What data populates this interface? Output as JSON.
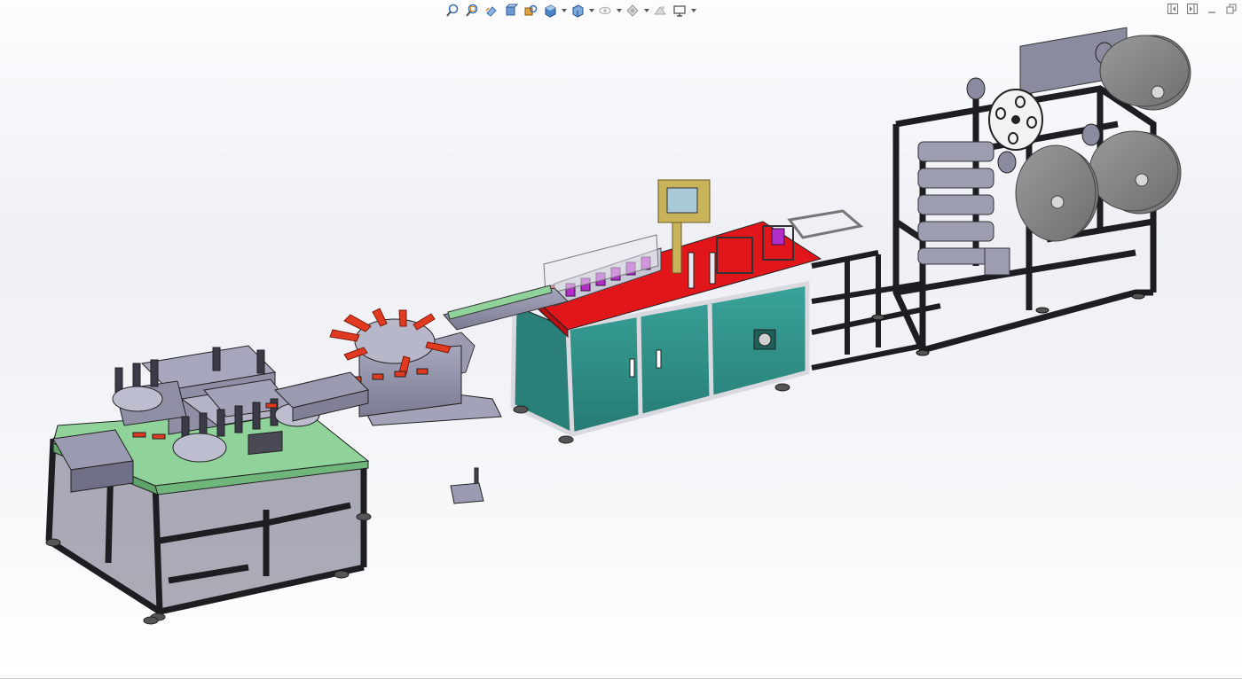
{
  "viewport": {
    "label": ""
  },
  "toolbar": {
    "items": [
      {
        "name": "zoom-to-fit-icon",
        "caret": false
      },
      {
        "name": "zoom-to-area-icon",
        "caret": false
      },
      {
        "name": "previous-view-icon",
        "caret": false
      },
      {
        "name": "section-view-icon",
        "caret": false
      },
      {
        "name": "dynamic-annotation-icon",
        "caret": false
      },
      {
        "name": "view-orientation-icon",
        "caret": true
      },
      {
        "name": "display-style-icon",
        "caret": true
      },
      {
        "name": "hide-show-items-icon",
        "caret": true
      },
      {
        "name": "edit-appearance-icon",
        "caret": true
      },
      {
        "name": "apply-scene-icon",
        "caret": false
      },
      {
        "name": "view-settings-icon",
        "caret": true
      }
    ]
  },
  "window_controls": [
    "tile-left-icon",
    "tile-right-icon",
    "minimize-icon",
    "restore-icon"
  ],
  "colors": {
    "frame": "#1d1d22",
    "teal_panel": "#2f8e86",
    "red_top": "#e0161b",
    "green_top": "#8fd39a",
    "grey_steel": "#8e8fa4",
    "roll": "#8b8b8b",
    "purple": "#b22ec8",
    "yellow": "#c8b25a"
  }
}
